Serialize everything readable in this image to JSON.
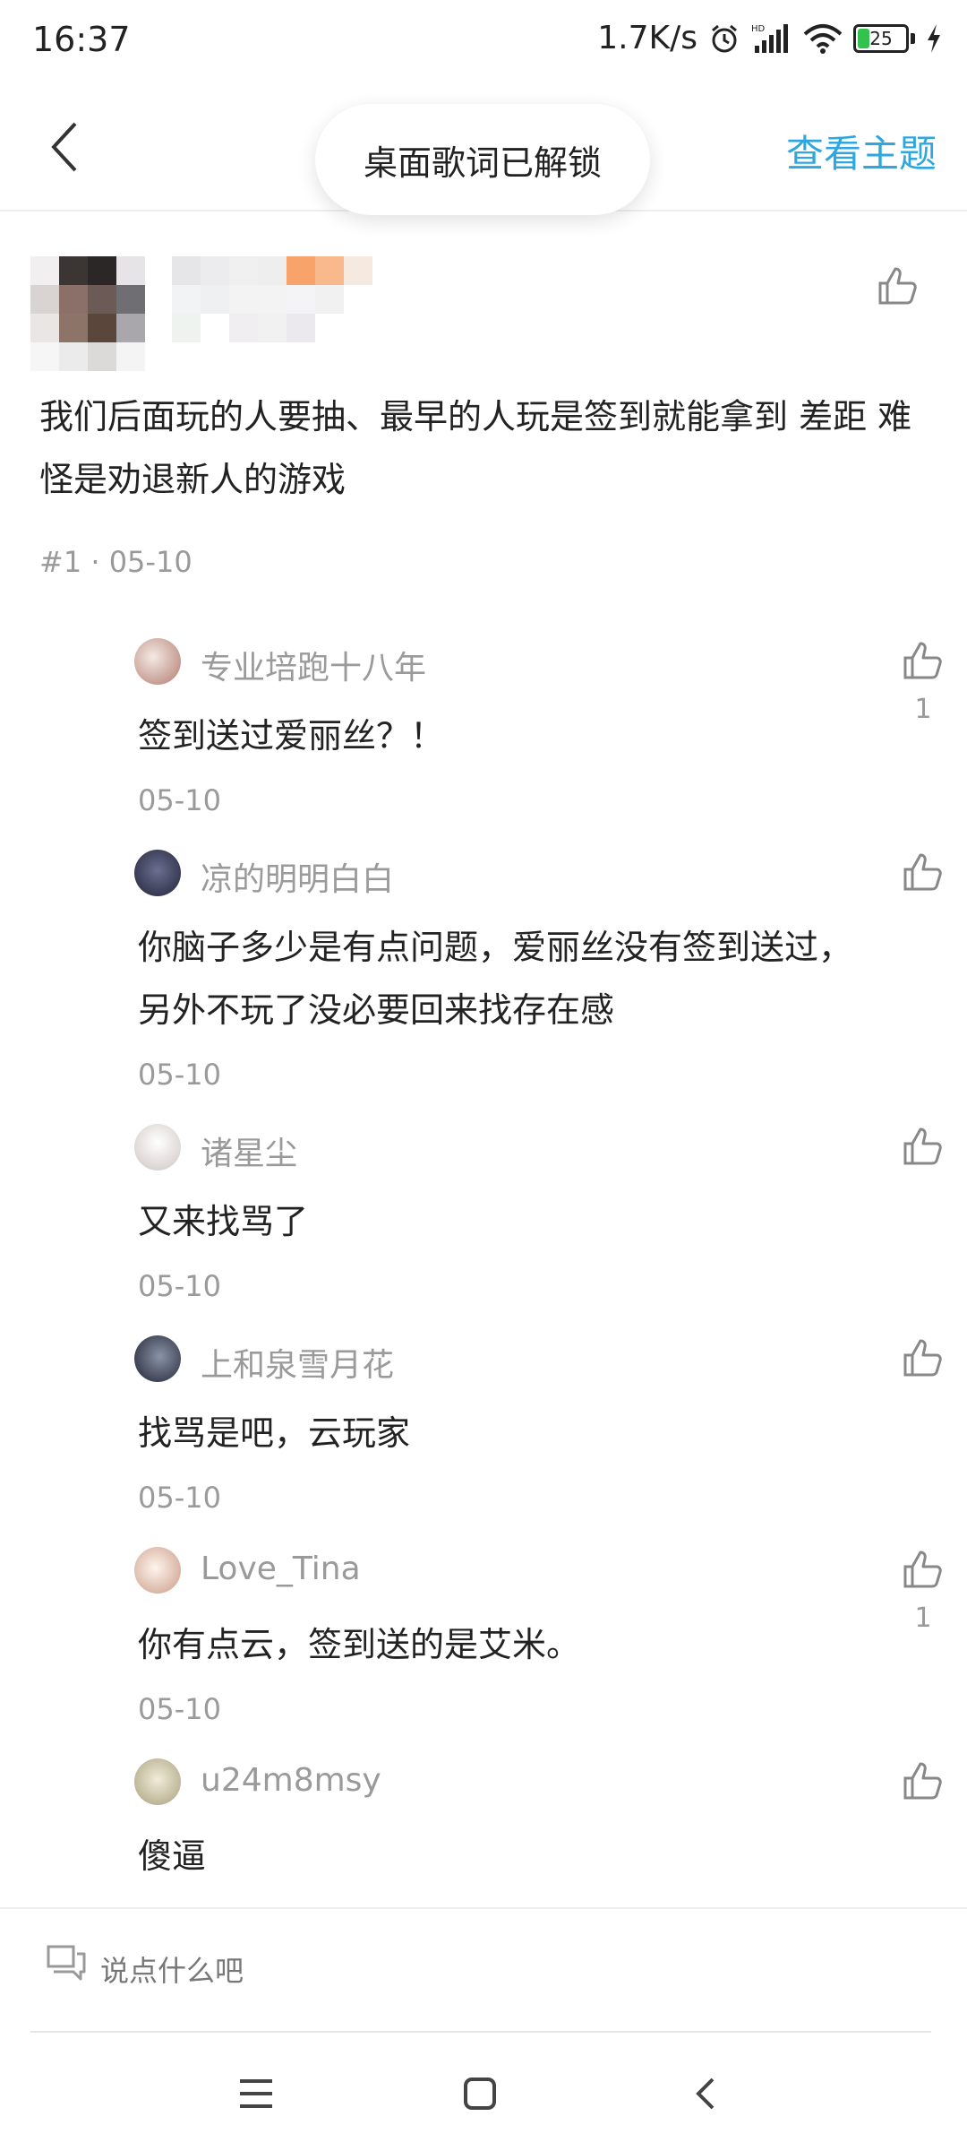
{
  "status_bar": {
    "time": "16:37",
    "network_speed": "1.7K/s",
    "battery_level": "25",
    "battery_percent": 25,
    "icons": [
      "alarm-icon",
      "hd-signal-icon",
      "wifi-icon",
      "battery-icon",
      "charging-icon"
    ]
  },
  "header": {
    "back_icon": "chevron-left-icon",
    "toast": "桌面歌词已解锁",
    "view_topic": "查看主题"
  },
  "post": {
    "body": "我们后面玩的人要抽、最早的人玩是签到就能拿到 差距 难怪是劝退新人的游戏",
    "meta": "#1 · 05-10"
  },
  "replies": [
    {
      "name": "专业培跑十八年",
      "text": "签到送过爱丽丝？！",
      "date": "05-10",
      "likes": "1",
      "avatar_color": "#c9a19a"
    },
    {
      "name": "凉的明明白白",
      "text": "你脑子多少是有点问题，爱丽丝没有签到送过，另外不玩了没必要回来找存在感",
      "date": "05-10",
      "likes": "",
      "avatar_color": "#3b3d55"
    },
    {
      "name": "诸星尘",
      "text": "又来找骂了",
      "date": "05-10",
      "likes": "",
      "avatar_color": "#e4dcdc"
    },
    {
      "name": "上和泉雪月花",
      "text": "找骂是吧，云玩家",
      "date": "05-10",
      "likes": "",
      "avatar_color": "#3a4152"
    },
    {
      "name": "Love_Tina",
      "text": "你有点云，签到送的是艾米。",
      "date": "05-10",
      "likes": "1",
      "avatar_color": "#e9d2c6"
    },
    {
      "name": "u24m8msy",
      "text": "傻逼",
      "date": "",
      "likes": "",
      "avatar_color": "#d8d4be"
    }
  ],
  "comment_bar": {
    "icon": "comment-icon",
    "placeholder": "说点什么吧"
  },
  "nav_bar": {
    "icons": [
      "menu-icon",
      "home-icon",
      "back-icon"
    ]
  },
  "colors": {
    "accent": "#2ea7e0",
    "meta_text": "#9a9a9a",
    "battery": "#33c24d"
  }
}
